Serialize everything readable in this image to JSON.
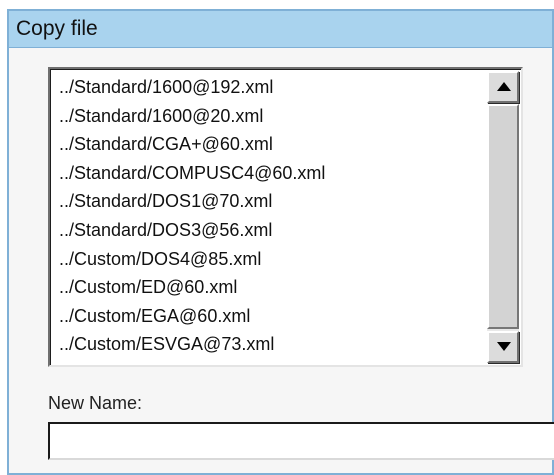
{
  "dialog": {
    "title": "Copy file"
  },
  "file_list": {
    "items": [
      "../Standard/1600@192.xml",
      "../Standard/1600@20.xml",
      "../Standard/CGA+@60.xml",
      "../Standard/COMPUSC4@60.xml",
      "../Standard/DOS1@70.xml",
      "../Standard/DOS3@56.xml",
      "../Custom/DOS4@85.xml",
      "../Custom/ED@60.xml",
      "../Custom/EGA@60.xml",
      "../Custom/ESVGA@73.xml"
    ],
    "scroll_up_icon": "triangle-up",
    "scroll_down_icon": "triangle-down"
  },
  "new_name": {
    "label": "New Name:",
    "value": ""
  }
}
